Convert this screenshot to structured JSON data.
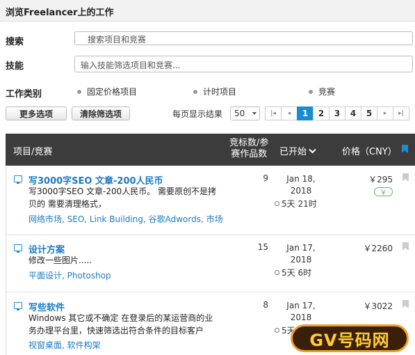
{
  "header": {
    "title": "浏览Freelancer上的工作"
  },
  "search": {
    "label": "搜索",
    "placeholder": "搜索项目和竞赛"
  },
  "skills": {
    "label": "技能",
    "placeholder": "输入技能筛选项目和竞赛..."
  },
  "work_type": {
    "label": "工作类别",
    "options": [
      "固定价格项目",
      "计时项目",
      "竞赛"
    ]
  },
  "toolbar": {
    "more_options": "更多选项",
    "clear_filters": "清除筛选项",
    "per_page_label": "每页显示结果",
    "per_page_value": "50"
  },
  "pagination": {
    "first": "|◂",
    "prev": "◂",
    "pages": [
      "1",
      "2",
      "3",
      "4",
      "5"
    ],
    "active_page": 1,
    "next": "▸",
    "last": "▸|"
  },
  "table": {
    "col_project": "项目/竞赛",
    "col_bids_line1": "竞标数/参",
    "col_bids_line2": "赛作品数",
    "col_started": "已开始",
    "col_price": "价格（CNY）"
  },
  "projects": [
    {
      "title": "写3000字SEO 文章-200人民币",
      "desc": "写3000字SEO 文章-200人民币。 需要原创不是拷贝的 需要清理格式，",
      "tags": "网络市场, SEO, Link Building, 谷歌Adwords, 市场",
      "bids": "9",
      "date_line1": "Jan 18,",
      "date_line2": "2018",
      "remaining": "5天 21时",
      "price": "￥295",
      "badge": "￥"
    },
    {
      "title": "设计方案",
      "desc": "修改一些图片.....",
      "tags": "平面设计, Photoshop",
      "bids": "15",
      "date_line1": "Jan 17,",
      "date_line2": "2018",
      "remaining": "5天 6时",
      "price": "￥2260"
    },
    {
      "title": "写些软件",
      "desc": "Windows 其它或不确定 在登录后的某运营商的业务办理平台里，快速筛选出符合条件的目标客户",
      "tags": "视窗桌面, 软件构架",
      "bids": "8",
      "date_line1": "Jan 17,",
      "date_line2": "2018",
      "remaining": "5天",
      "price": "￥3022"
    }
  ],
  "watermark": {
    "text": "GV号码网"
  },
  "colors": {
    "accent": "#1a8bd3",
    "header_bg": "#3c3c3c",
    "link": "#1a7ac4"
  }
}
